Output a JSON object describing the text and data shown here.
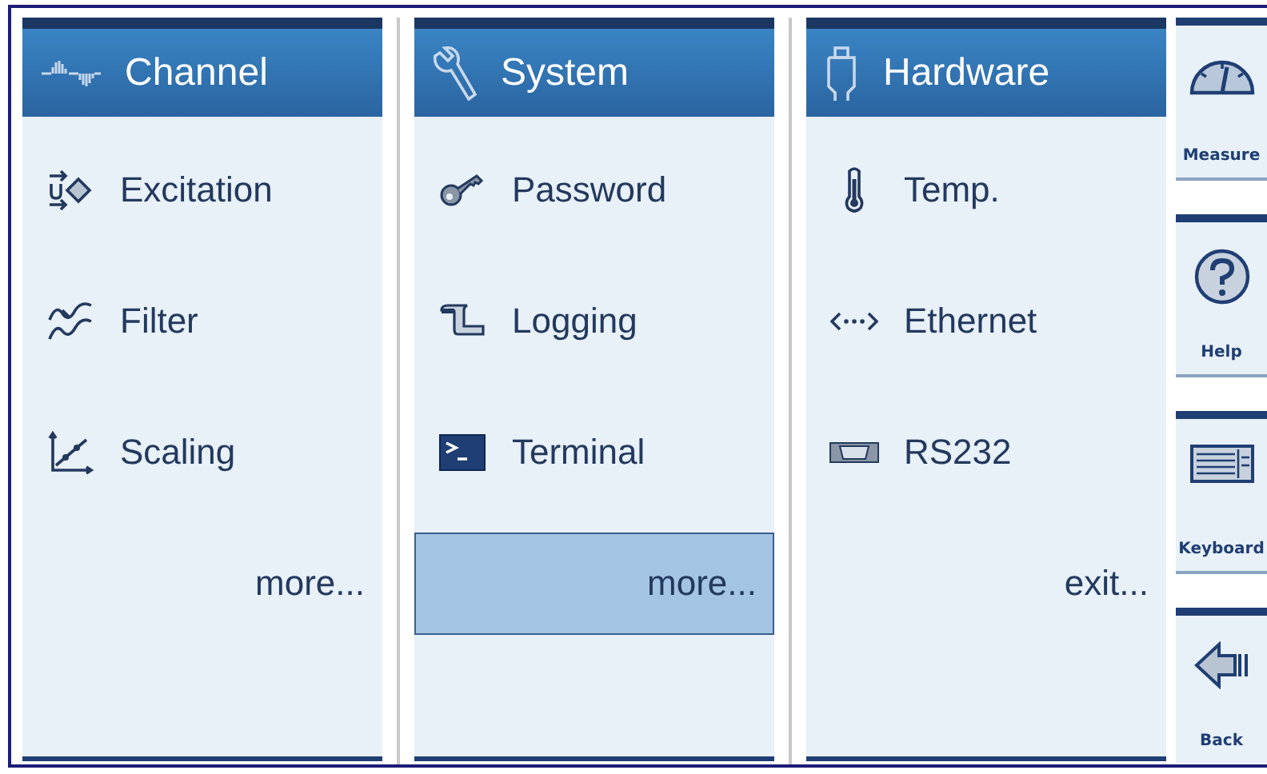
{
  "menus": [
    {
      "title": "Channel",
      "items": [
        {
          "label": "Excitation",
          "selected": false
        },
        {
          "label": "Filter",
          "selected": false
        },
        {
          "label": "Scaling",
          "selected": false
        },
        {
          "label": "more...",
          "selected": false,
          "kind": "link"
        }
      ]
    },
    {
      "title": "System",
      "items": [
        {
          "label": "Password",
          "selected": false
        },
        {
          "label": "Logging",
          "selected": false
        },
        {
          "label": "Terminal",
          "selected": false
        },
        {
          "label": "more...",
          "selected": true,
          "kind": "link"
        }
      ]
    },
    {
      "title": "Hardware",
      "items": [
        {
          "label": "Temp.",
          "selected": false
        },
        {
          "label": "Ethernet",
          "selected": false
        },
        {
          "label": "RS232",
          "selected": false
        },
        {
          "label": "exit...",
          "selected": false,
          "kind": "link"
        }
      ]
    }
  ],
  "side_buttons": [
    {
      "label": "Measure"
    },
    {
      "label": "Help"
    },
    {
      "label": "Keyboard"
    },
    {
      "label": "Back"
    }
  ]
}
